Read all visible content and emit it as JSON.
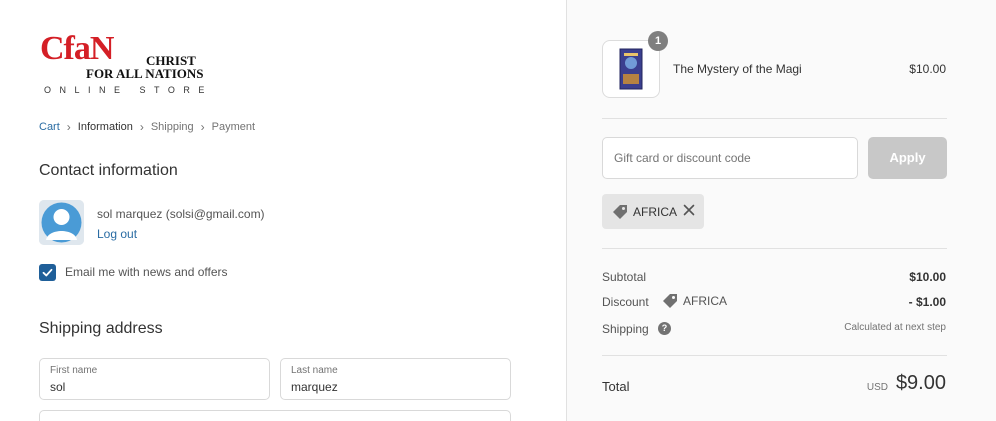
{
  "logo": {
    "mark": "CfaN",
    "line1": "CHRIST",
    "line2": "FOR ALL NATIONS",
    "store": "ONLINE STORE"
  },
  "breadcrumb": {
    "items": [
      "Cart",
      "Information",
      "Shipping",
      "Payment"
    ]
  },
  "contact": {
    "heading": "Contact information",
    "user": "sol marquez (solsi@gmail.com)",
    "logout": "Log out",
    "newsletter_label": "Email me with news and offers",
    "newsletter_checked": true
  },
  "shipping": {
    "heading": "Shipping address",
    "first_name_label": "First name",
    "first_name_value": "sol",
    "last_name_label": "Last name",
    "last_name_value": "marquez"
  },
  "cart": {
    "quantity": "1",
    "product_name": "The Mystery of the Magi",
    "product_price": "$10.00"
  },
  "discount": {
    "placeholder": "Gift card or discount code",
    "apply_label": "Apply",
    "applied_code": "AFRICA"
  },
  "summary": {
    "subtotal_label": "Subtotal",
    "subtotal_value": "$10.00",
    "discount_label": "Discount",
    "discount_code": "AFRICA",
    "discount_value": "- $1.00",
    "shipping_label": "Shipping",
    "shipping_value": "Calculated at next step",
    "total_label": "Total",
    "currency": "USD",
    "total_value": "$9.00"
  },
  "colors": {
    "link": "#2a6ca3",
    "checkbox": "#1f5f99",
    "logo_red": "#d41f26",
    "apply_disabled": "#c8c8c8"
  }
}
